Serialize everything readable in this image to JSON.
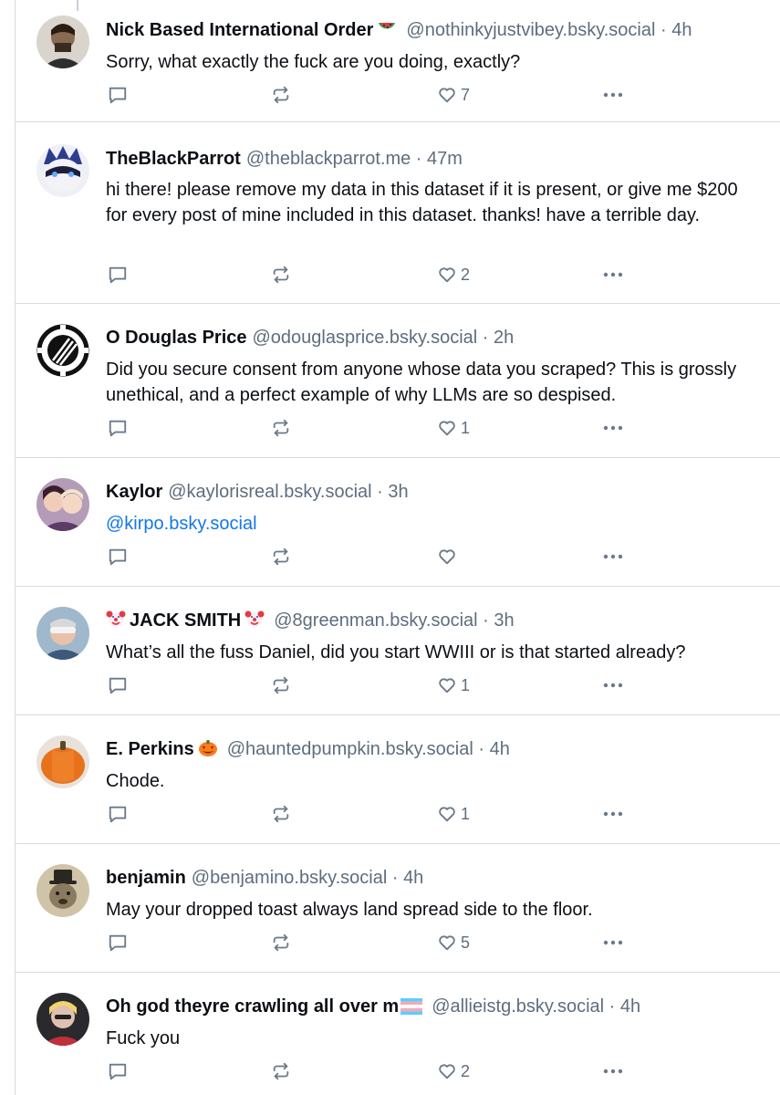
{
  "posts": [
    {
      "display_name": "Nick Based International Order",
      "name_emoji_after": "watermelon",
      "handle": "@nothinkyjustvibey.bsky.social",
      "separator": " · ",
      "time": "4h",
      "text": "Sorry, what exactly the fuck are you doing, exactly?",
      "likes": "7"
    },
    {
      "display_name": "TheBlackParrot",
      "handle": "@theblackparrot.me",
      "separator": " · ",
      "time": "47m",
      "text": "hi there! please remove my data in this dataset if it is present, or give me $200 for every post of mine included in this dataset. thanks! have a terrible day.",
      "likes": "2"
    },
    {
      "display_name": "O Douglas Price",
      "handle": "@odouglasprice.bsky.social",
      "separator": " · ",
      "time": "2h",
      "text": "Did you secure consent from anyone whose data you scraped?  This is grossly unethical, and a perfect example of why LLMs are so despised.",
      "likes": "1"
    },
    {
      "display_name": "Kaylor",
      "handle": "@kaylorisreal.bsky.social",
      "separator": " · ",
      "time": "3h",
      "mention": "@kirpo.bsky.social",
      "likes": ""
    },
    {
      "display_name": "JACK SMITH",
      "name_emoji_before": "clown",
      "name_emoji_after": "clown",
      "handle": "@8greenman.bsky.social",
      "separator": " · ",
      "time": "3h",
      "text": "What’s all the fuss Daniel, did you start WWIII or is that started already?",
      "likes": "1"
    },
    {
      "display_name": "E. Perkins",
      "name_emoji_after": "jack-o-lantern",
      "handle": "@hauntedpumpkin.bsky.social",
      "separator": " · ",
      "time": "4h",
      "text": "Chode.",
      "likes": "1"
    },
    {
      "display_name": "benjamin",
      "handle": "@benjamino.bsky.social",
      "separator": " · ",
      "time": "4h",
      "text": "May your dropped toast always land spread side to the floor.",
      "likes": "5"
    },
    {
      "display_name": "Oh god theyre crawling all over m",
      "name_emoji_after": "transgender-flag",
      "handle": "@allieistg.bsky.social",
      "separator": " · ",
      "time": "4h",
      "text": "Fuck you",
      "likes": "2"
    }
  ],
  "icons": {
    "reply": "reply-icon",
    "repost": "repost-icon",
    "like": "heart-icon",
    "more": "more-options-icon"
  },
  "colors": {
    "text": "#0b0f14",
    "muted": "#5e6d7d",
    "icon": "#6b7a89",
    "link": "#1477e8",
    "divider": "#d4dbe2"
  }
}
